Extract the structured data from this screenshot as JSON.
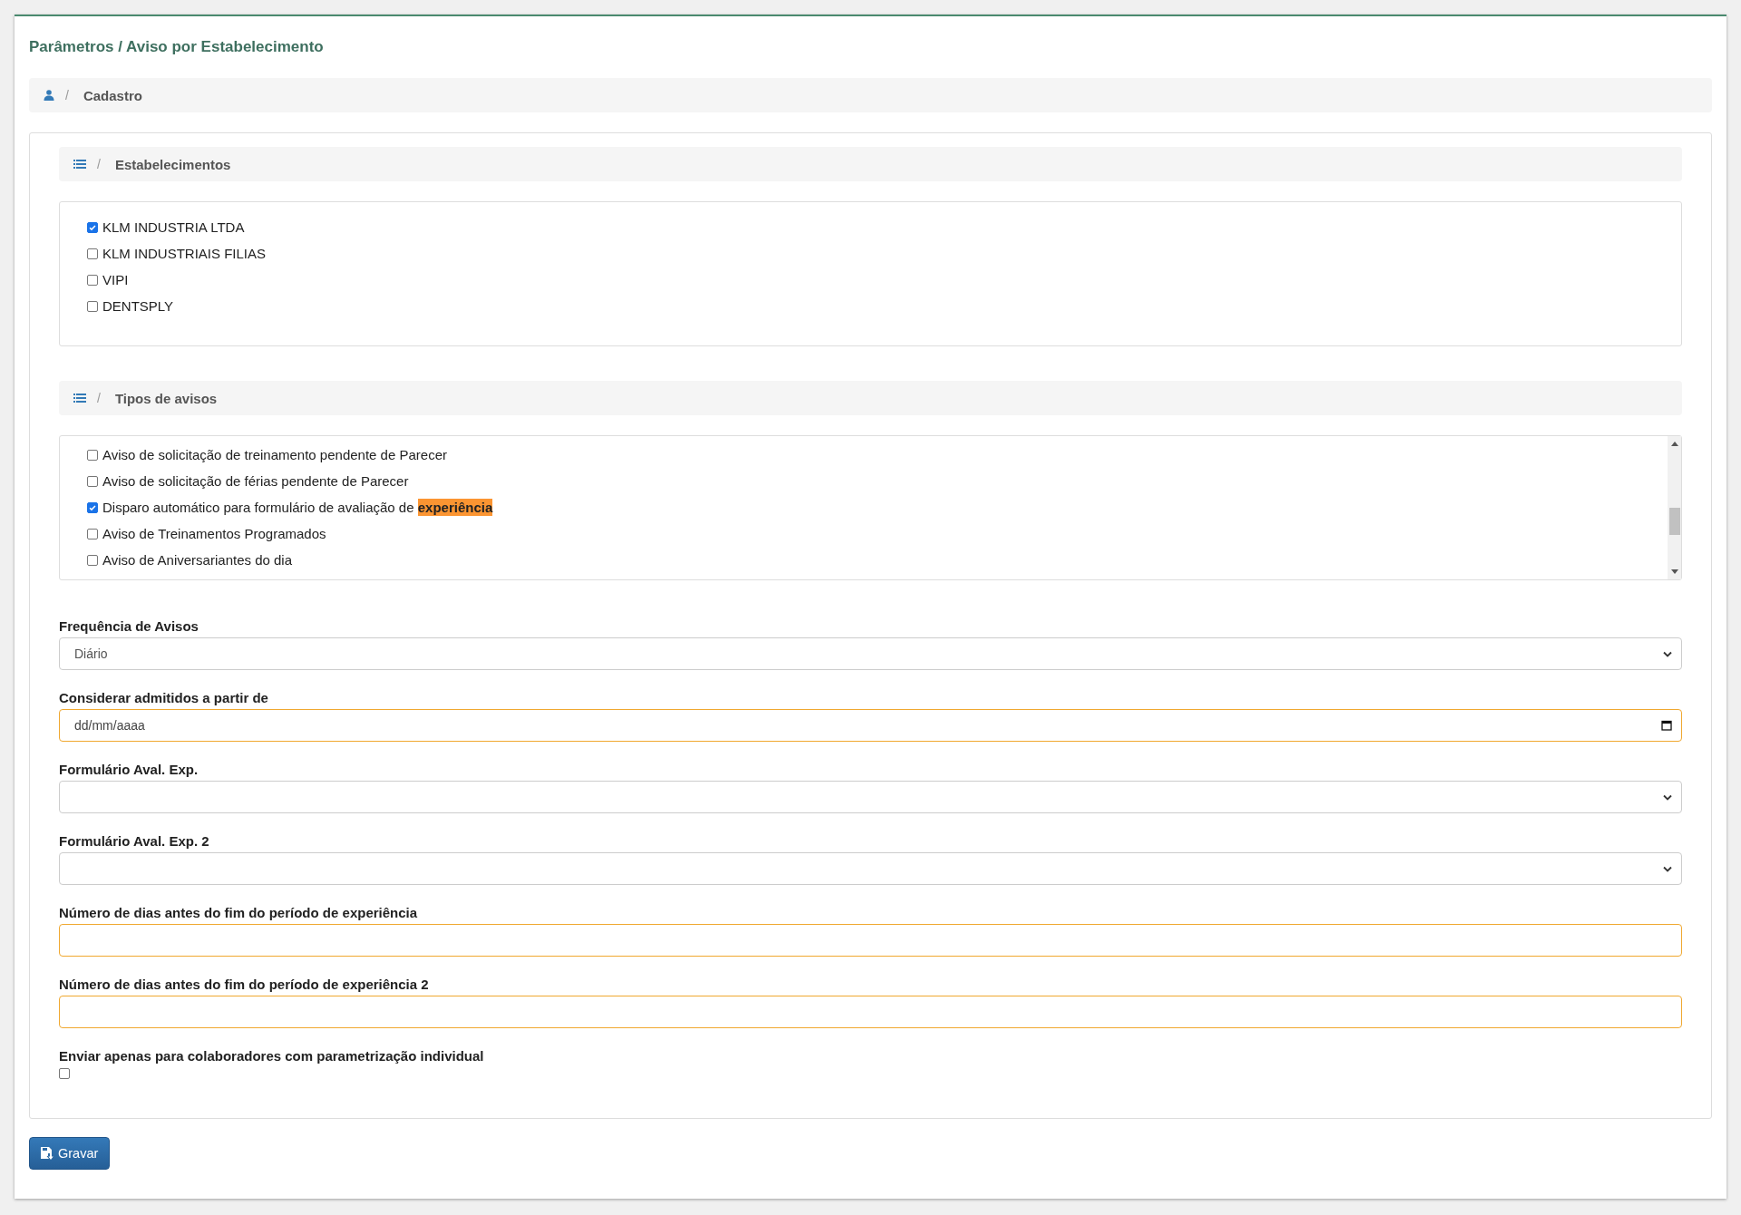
{
  "page_title": "Parâmetros / Aviso por Estabelecimento",
  "breadcrumb": {
    "separator": "/",
    "label": "Cadastro"
  },
  "sections": [
    {
      "separator": "/",
      "title": "Estabelecimentos",
      "scrollable": false,
      "items": [
        {
          "label": "KLM INDUSTRIA LTDA",
          "checked": true
        },
        {
          "label": "KLM INDUSTRIAIS FILIAS",
          "checked": false
        },
        {
          "label": "VIPI",
          "checked": false
        },
        {
          "label": "DENTSPLY",
          "checked": false
        }
      ]
    },
    {
      "separator": "/",
      "title": "Tipos de avisos",
      "scrollable": true,
      "items": [
        {
          "label": "Aviso de solicitação de treinamento pendente de Parecer",
          "checked": false
        },
        {
          "label": "Aviso de solicitação de férias pendente de Parecer",
          "checked": false
        },
        {
          "label": "Disparo automático para formulário de avaliação de ",
          "highlight": "experiência",
          "checked": true
        },
        {
          "label": "Aviso de Treinamentos Programados",
          "checked": false
        },
        {
          "label": "Aviso de Aniversariantes do dia",
          "checked": false
        }
      ]
    }
  ],
  "fields": [
    {
      "kind": "select",
      "label": "Frequência de Avisos",
      "value": "Diário",
      "highlighted": false
    },
    {
      "kind": "date",
      "label": "Considerar admitidos a partir de",
      "placeholder": "dd/mm/aaaa",
      "highlighted": true
    },
    {
      "kind": "select",
      "label": "Formulário Aval. Exp.",
      "highlighted": false
    },
    {
      "kind": "select",
      "label": "Formulário Aval. Exp. 2",
      "highlighted": false
    },
    {
      "kind": "text",
      "label": "Número de dias antes do fim do período de experiência",
      "highlighted": true
    },
    {
      "kind": "text",
      "label": "Número de dias antes do fim do período de experiência 2",
      "highlighted": true
    },
    {
      "kind": "checkbox",
      "label": "Enviar apenas para colaboradores com parametrização individual",
      "checked": false
    }
  ],
  "save_button": {
    "label": "Gravar"
  }
}
